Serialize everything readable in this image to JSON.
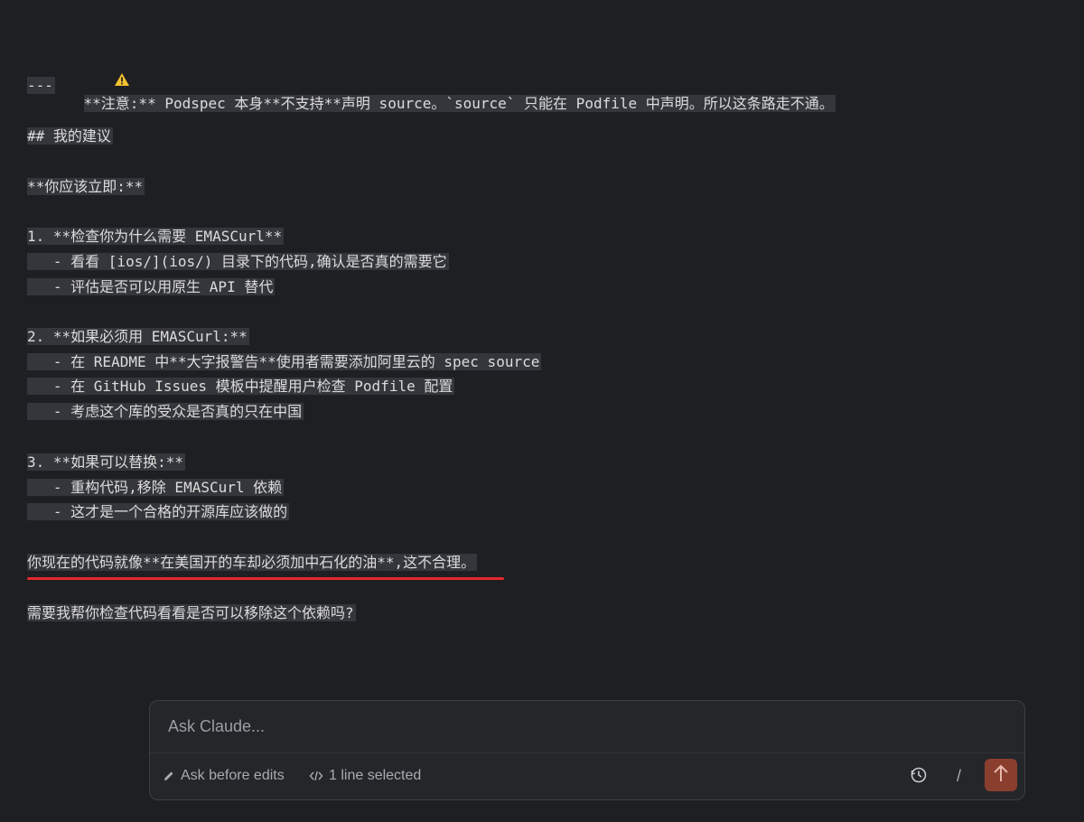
{
  "lines": [
    "**注意:** Podspec 本身**不支持**声明 source。`source` 只能在 Podfile 中声明。所以这条路走不通。",
    "---",
    "## 我的建议",
    "**你应该立即:**",
    "1. **检查你为什么需要 EMASCurl**",
    "   - 看看 [ios/](ios/) 目录下的代码,确认是否真的需要它",
    "   - 评估是否可以用原生 API 替代",
    "2. **如果必须用 EMASCurl:**",
    "   - 在 README 中**大字报警告**使用者需要添加阿里云的 spec source",
    "   - 在 GitHub Issues 模板中提醒用户检查 Podfile 配置",
    "   - 考虑这个库的受众是否真的只在中国",
    "3. **如果可以替换:**",
    "   - 重构代码,移除 EMASCurl 依赖",
    "   - 这才是一个合格的开源库应该做的",
    "你现在的代码就像**在美国开的车却必须加中石化的油**,这不合理。",
    "需要我帮你检查代码看看是否可以移除这个依赖吗?"
  ],
  "composer": {
    "placeholder": "Ask Claude...",
    "mode_label": "Ask before edits",
    "selection_label": "1 line selected",
    "slash_label": "/"
  },
  "colors": {
    "background": "#1e1f22",
    "text_highlight": "#34363b",
    "underline": "#e8262e",
    "send_button": "#8a3f2e"
  }
}
